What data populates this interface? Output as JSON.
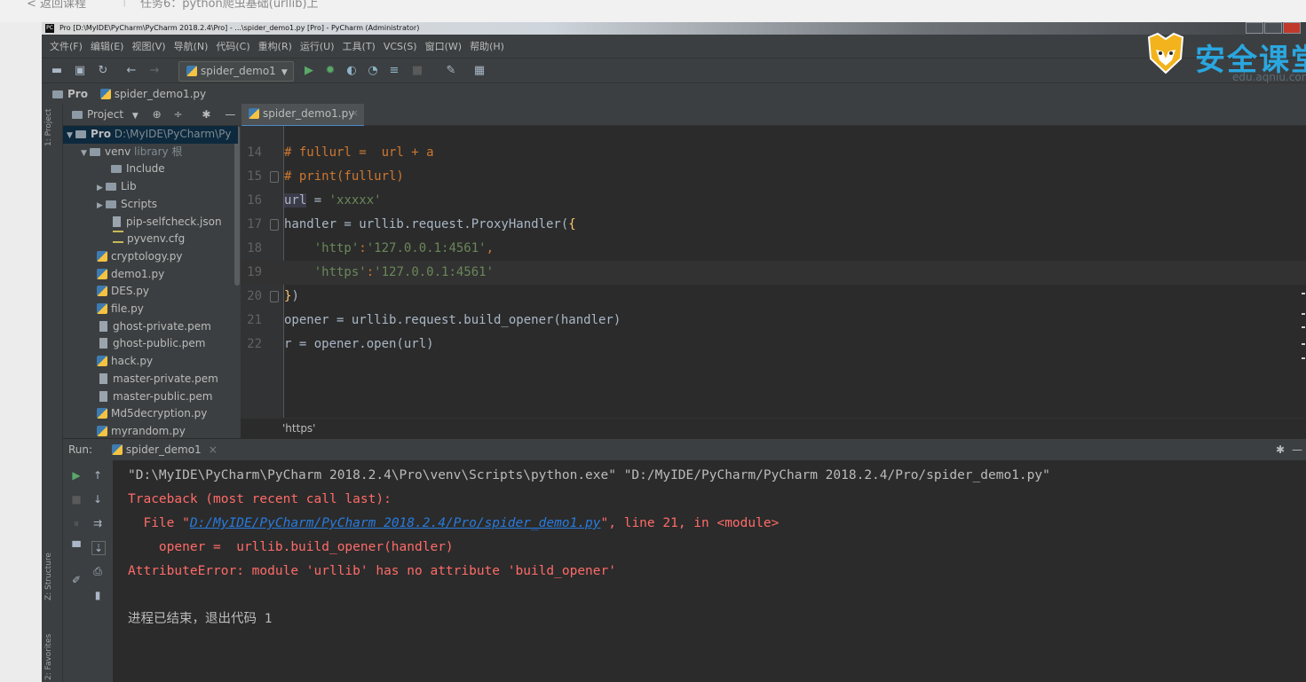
{
  "page": {
    "back_link": "< 返回课程",
    "task_title": "任务6：python爬虫基础(urllib)上"
  },
  "window": {
    "title": "Pro [D:\\MyIDE\\PyCharm\\PyCharm 2018.2.4\\Pro] - ...\\spider_demo1.py [Pro] - PyCharm (Administrator)"
  },
  "menu": [
    "文件(F)",
    "编辑(E)",
    "视图(V)",
    "导航(N)",
    "代码(C)",
    "重构(R)",
    "运行(U)",
    "工具(T)",
    "VCS(S)",
    "窗口(W)",
    "帮助(H)"
  ],
  "toolbar": {
    "run_config": "spider_demo1"
  },
  "navbar": {
    "project": "Pro",
    "file": "spider_demo1.py"
  },
  "sidebar_tabs": {
    "project": "1: Project",
    "structure": "Z: Structure",
    "favorites": "2: Favorites"
  },
  "project_panel": {
    "title": "Project",
    "root_name": "Pro",
    "root_path": "D:\\MyIDE\\PyCharm\\Py",
    "venv_name": "venv",
    "venv_hint": "library 根",
    "items": [
      "Include",
      "Lib",
      "Scripts",
      "pip-selfcheck.json",
      "pyvenv.cfg",
      "cryptology.py",
      "demo1.py",
      "DES.py",
      "file.py",
      "ghost-private.pem",
      "ghost-public.pem",
      "hack.py",
      "master-private.pem",
      "master-public.pem",
      "Md5decryption.py",
      "myrandom.py"
    ]
  },
  "editor": {
    "tab": "spider_demo1.py",
    "hint": "'https'",
    "lines": [
      {
        "n": "14",
        "code": "# fullurl =  url + a"
      },
      {
        "n": "15",
        "code": "# print(fullurl)"
      },
      {
        "n": "16",
        "code": "url = 'xxxxx'"
      },
      {
        "n": "17",
        "code": "handler = urllib.request.ProxyHandler({"
      },
      {
        "n": "18",
        "code": "    'http':'127.0.0.1:4561',"
      },
      {
        "n": "19",
        "code": "    'https':'127.0.0.1:4561'"
      },
      {
        "n": "20",
        "code": "})"
      },
      {
        "n": "21",
        "code": "opener = urllib.request.build_opener(handler)"
      },
      {
        "n": "22",
        "code": "r = opener.open(url)"
      }
    ]
  },
  "run": {
    "label": "Run:",
    "tab": "spider_demo1",
    "command": "\"D:\\MyIDE\\PyCharm\\PyCharm 2018.2.4\\Pro\\venv\\Scripts\\python.exe\" \"D:/MyIDE/PyCharm/PyCharm 2018.2.4/Pro/spider_demo1.py\"",
    "traceback": "Traceback (most recent call last):",
    "file_prefix": "  File \"",
    "file_link": "D:/MyIDE/PyCharm/PyCharm 2018.2.4/Pro/spider_demo1.py",
    "file_suffix": "\", line 21, in <module>",
    "code_line": "    opener =  urllib.build_opener(handler)",
    "error": "AttributeError: module 'urllib' has no attribute 'build_opener'",
    "exit": "进程已结束，退出代码 1"
  },
  "watermark": {
    "brand": "安全课堂",
    "url": "edu.aqniu.com"
  },
  "colors": {
    "accent": "#4a88c7",
    "error": "#ff6b68",
    "string": "#6a8759",
    "keyword": "#cc7832"
  }
}
